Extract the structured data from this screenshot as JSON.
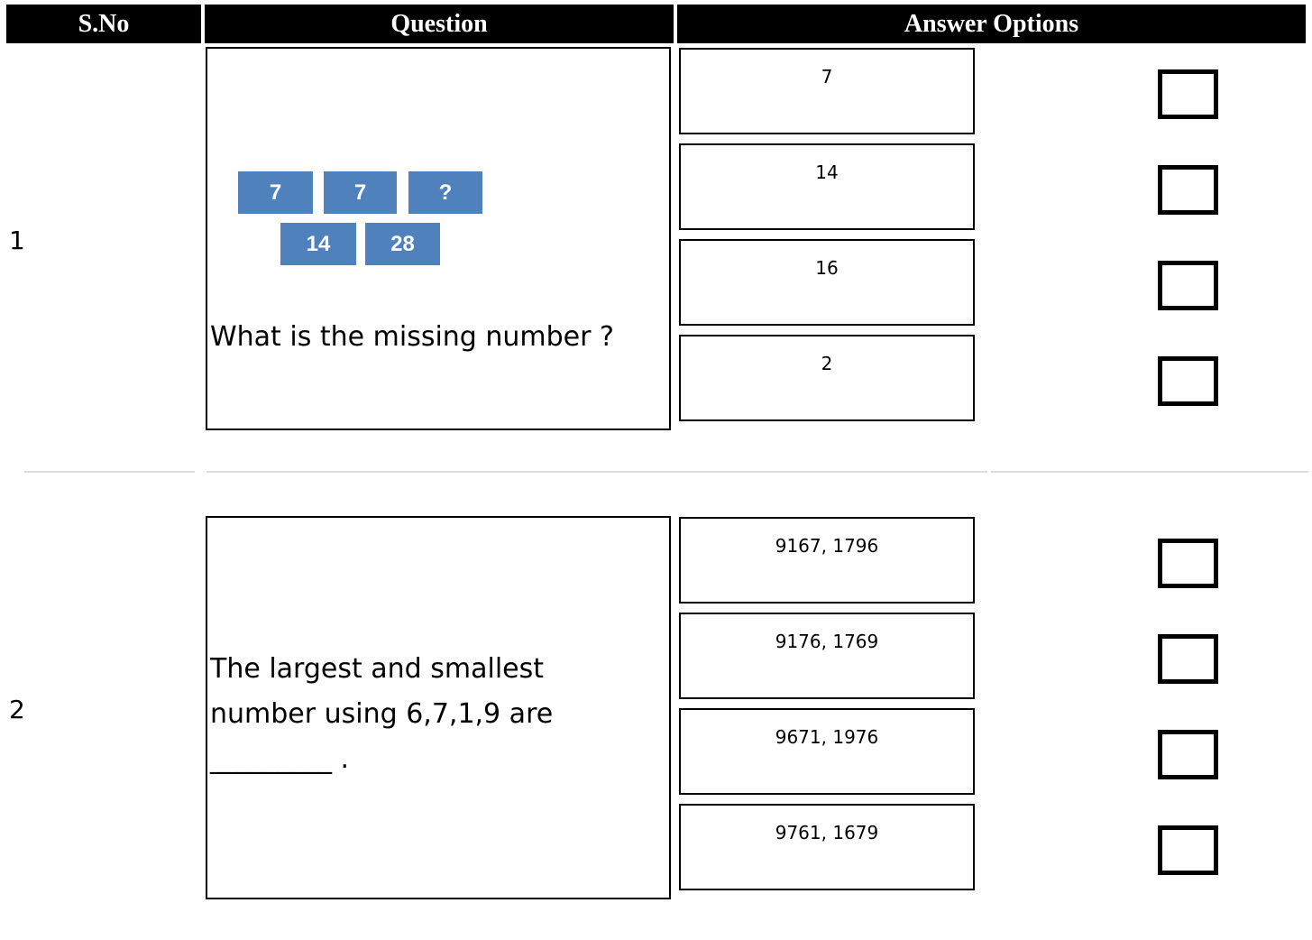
{
  "header": {
    "sno_label": "S.No",
    "question_label": "Question",
    "answer_label": "Answer Options"
  },
  "questions": [
    {
      "sno": "1",
      "figure_tiles": [
        "7",
        "7",
        "?",
        "14",
        "28"
      ],
      "text": "What is the missing number ?",
      "options": [
        "7",
        "14",
        "16",
        "2"
      ]
    },
    {
      "sno": "2",
      "text": "The largest and smallest\nnumber using 6,7,1,9 are\n_________ .",
      "options": [
        "9167, 1796",
        "9176, 1769",
        "9671, 1976",
        "9761, 1679"
      ]
    }
  ]
}
